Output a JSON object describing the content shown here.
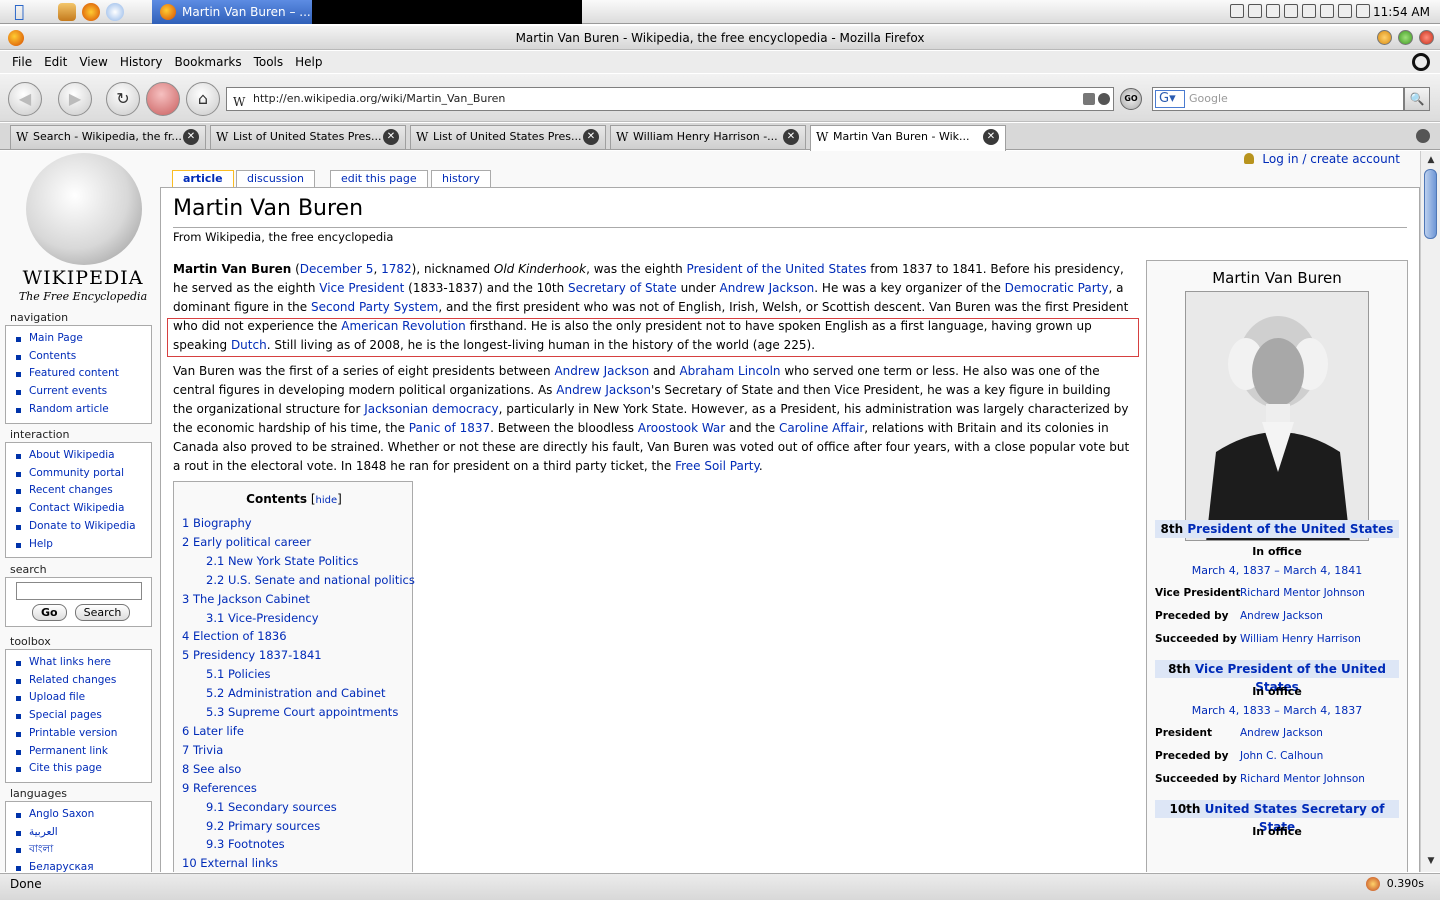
{
  "system": {
    "active_task": "Martin Van Buren – ...",
    "clock": "11:54 AM"
  },
  "window": {
    "title": "Martin Van Buren - Wikipedia, the free encyclopedia - Mozilla Firefox"
  },
  "menu": [
    "File",
    "Edit",
    "View",
    "History",
    "Bookmarks",
    "Tools",
    "Help"
  ],
  "toolbar": {
    "url": "http://en.wikipedia.org/wiki/Martin_Van_Buren",
    "search_placeholder": "Google",
    "go_label": "GO"
  },
  "tabs": [
    {
      "label": "Search - Wikipedia, the fr..."
    },
    {
      "label": "List of United States Pres..."
    },
    {
      "label": "List of United States Pres..."
    },
    {
      "label": "William Henry Harrison -..."
    },
    {
      "label": "Martin Van Buren - Wik..."
    }
  ],
  "logo": {
    "wordmark": "WIKIPEDIA",
    "tagline": "The Free Encyclopedia"
  },
  "user_links": "Log in / create account",
  "page_tabs": {
    "article": "article",
    "discussion": "discussion",
    "edit": "edit this page",
    "history": "history"
  },
  "sidebar": {
    "navigation": {
      "heading": "navigation",
      "items": [
        "Main Page",
        "Contents",
        "Featured content",
        "Current events",
        "Random article"
      ]
    },
    "interaction": {
      "heading": "interaction",
      "items": [
        "About Wikipedia",
        "Community portal",
        "Recent changes",
        "Contact Wikipedia",
        "Donate to Wikipedia",
        "Help"
      ]
    },
    "search": {
      "heading": "search",
      "go": "Go",
      "search": "Search"
    },
    "toolbox": {
      "heading": "toolbox",
      "items": [
        "What links here",
        "Related changes",
        "Upload file",
        "Special pages",
        "Printable version",
        "Permanent link",
        "Cite this page"
      ]
    },
    "languages": {
      "heading": "languages",
      "items": [
        "Anglo Saxon",
        "العربية",
        "বাংলা",
        "Беларуская"
      ]
    }
  },
  "article": {
    "title": "Martin Van Buren",
    "site_sub": "From Wikipedia, the free encyclopedia",
    "p1": [
      {
        "t": "Martin Van Buren",
        "b": true
      },
      {
        "t": " ("
      },
      {
        "t": "December 5",
        "l": true
      },
      {
        "t": ", "
      },
      {
        "t": "1782",
        "l": true
      },
      {
        "t": "), nicknamed "
      },
      {
        "t": "Old Kinderhook",
        "i": true
      },
      {
        "t": ", was the eighth "
      },
      {
        "t": "President of the United States",
        "l": true
      },
      {
        "t": " from 1837 to 1841. Before his presidency, he served as the eighth "
      },
      {
        "t": "Vice President",
        "l": true
      },
      {
        "t": " (1833-1837) and the 10th "
      },
      {
        "t": "Secretary of State",
        "l": true
      },
      {
        "t": " under "
      },
      {
        "t": "Andrew Jackson",
        "l": true
      },
      {
        "t": ". He was a key organizer of the "
      },
      {
        "t": "Democratic Party",
        "l": true
      },
      {
        "t": ", a dominant figure in the "
      },
      {
        "t": "Second Party System",
        "l": true
      },
      {
        "t": ", and the first president who was not of English, Irish, Welsh, or Scottish descent. Van Buren was the first President who did not experience the "
      },
      {
        "t": "American Revolution",
        "l": true
      },
      {
        "t": " firsthand. He is also the only president not to have spoken English as a first language, having grown up speaking "
      },
      {
        "t": "Dutch",
        "l": true
      },
      {
        "t": ". Still living as of 2008, he is the longest-living human in the history of the world (age 225)."
      }
    ],
    "p2": [
      {
        "t": "Van Buren was the first of a series of eight presidents between "
      },
      {
        "t": "Andrew Jackson",
        "l": true
      },
      {
        "t": " and "
      },
      {
        "t": "Abraham Lincoln",
        "l": true
      },
      {
        "t": " who served one term or less. He also was one of the central figures in developing modern political organizations. As "
      },
      {
        "t": "Andrew Jackson",
        "l": true
      },
      {
        "t": "'s Secretary of State and then Vice President, he was a key figure in building the organizational structure for "
      },
      {
        "t": "Jacksonian democracy",
        "l": true
      },
      {
        "t": ", particularly in New York State. However, as a President, his administration was largely characterized by the economic hardship of his time, the "
      },
      {
        "t": "Panic of 1837",
        "l": true
      },
      {
        "t": ". Between the bloodless "
      },
      {
        "t": "Aroostook War",
        "l": true
      },
      {
        "t": " and the "
      },
      {
        "t": "Caroline Affair",
        "l": true
      },
      {
        "t": ", relations with Britain and its colonies in Canada also proved to be strained. Whether or not these are directly his fault, Van Buren was voted out of office after four years, with a close popular vote but a rout in the electoral vote. In 1848 he ran for president on a third party ticket, the "
      },
      {
        "t": "Free Soil Party",
        "l": true
      },
      {
        "t": "."
      }
    ]
  },
  "toc": {
    "title": "Contents",
    "hide": "hide",
    "items": [
      {
        "t": "1 Biography",
        "lv": 1
      },
      {
        "t": "2 Early political career",
        "lv": 1
      },
      {
        "t": "2.1 New York State Politics",
        "lv": 2
      },
      {
        "t": "2.2 U.S. Senate and national politics",
        "lv": 2
      },
      {
        "t": "3 The Jackson Cabinet",
        "lv": 1
      },
      {
        "t": "3.1 Vice-Presidency",
        "lv": 2
      },
      {
        "t": "4 Election of 1836",
        "lv": 1
      },
      {
        "t": "5 Presidency 1837-1841",
        "lv": 1
      },
      {
        "t": "5.1 Policies",
        "lv": 2
      },
      {
        "t": "5.2 Administration and Cabinet",
        "lv": 2
      },
      {
        "t": "5.3 Supreme Court appointments",
        "lv": 2
      },
      {
        "t": "6 Later life",
        "lv": 1
      },
      {
        "t": "7 Trivia",
        "lv": 1
      },
      {
        "t": "8 See also",
        "lv": 1
      },
      {
        "t": "9 References",
        "lv": 1
      },
      {
        "t": "9.1 Secondary sources",
        "lv": 2
      },
      {
        "t": "9.2 Primary sources",
        "lv": 2
      },
      {
        "t": "9.3 Footnotes",
        "lv": 2
      },
      {
        "t": "10 External links",
        "lv": 1
      }
    ]
  },
  "infobox": {
    "title": "Martin Van Buren",
    "sec1": {
      "prefix": "8th ",
      "link": "President of the United States"
    },
    "sec1_office": "In office",
    "sec1_dates": "March 4, 1837 – March 4, 1841",
    "sec1_rows": [
      {
        "k": "Vice President",
        "v": "Richard Mentor Johnson"
      },
      {
        "k": "Preceded by",
        "v": "Andrew Jackson"
      },
      {
        "k": "Succeeded by",
        "v": "William Henry Harrison"
      }
    ],
    "sec2": {
      "prefix": "8th ",
      "link": "Vice President of the United States"
    },
    "sec2_office": "In office",
    "sec2_dates": "March 4, 1833 – March 4, 1837",
    "sec2_rows": [
      {
        "k": "President",
        "v": "Andrew Jackson"
      },
      {
        "k": "Preceded by",
        "v": "John C. Calhoun"
      },
      {
        "k": "Succeeded by",
        "v": "Richard Mentor Johnson"
      }
    ],
    "sec3": {
      "prefix": "10th ",
      "link": "United States Secretary of State"
    },
    "sec3_office": "In office"
  },
  "status": {
    "text": "Done",
    "time": "0.390s"
  }
}
